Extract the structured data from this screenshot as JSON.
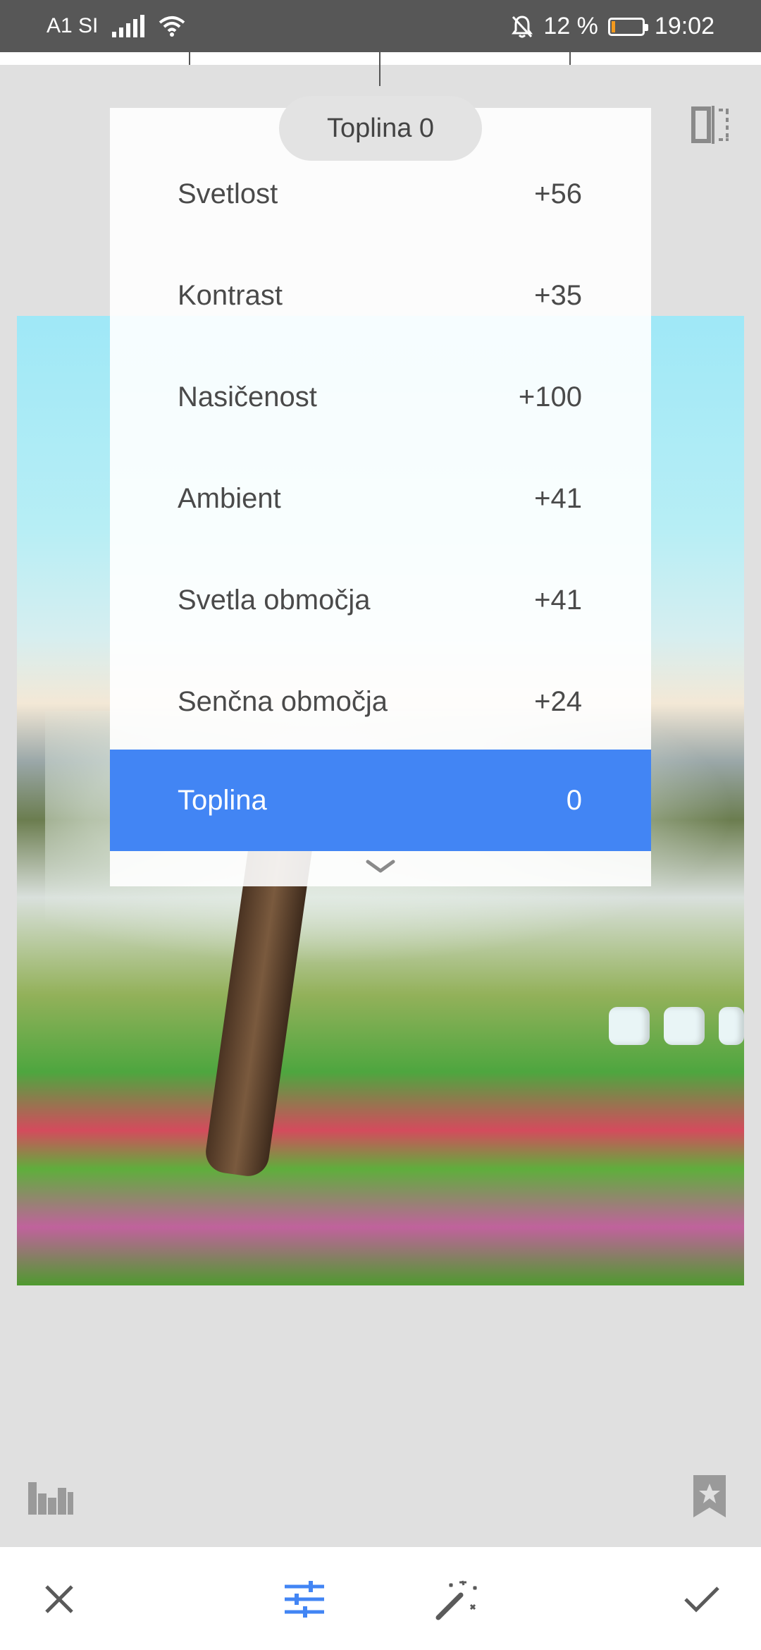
{
  "status_bar": {
    "carrier": "A1 SI",
    "battery_percent": "12 %",
    "time": "19:02",
    "battery_level": 0.12,
    "battery_color": "#f39a1e"
  },
  "toast": {
    "text": "Toplina 0"
  },
  "adjustments": [
    {
      "label": "Svetlost",
      "value": "+56"
    },
    {
      "label": "Kontrast",
      "value": "+35"
    },
    {
      "label": "Nasičenost",
      "value": "+100"
    },
    {
      "label": "Ambient",
      "value": "+41"
    },
    {
      "label": "Svetla območja",
      "value": "+41"
    },
    {
      "label": "Senčna območja",
      "value": "+24"
    },
    {
      "label": "Toplina",
      "value": "0",
      "selected": true
    }
  ],
  "colors": {
    "accent": "#4285f4",
    "statusbar": "#575757",
    "background": "#e0e0e0"
  },
  "icons": {
    "compare": "compare-icon",
    "histogram": "histogram-icon",
    "bookmark": "bookmark-star-icon",
    "cancel": "close-icon",
    "tune": "tune-sliders-icon",
    "auto": "magic-wand-icon",
    "apply": "check-icon"
  }
}
